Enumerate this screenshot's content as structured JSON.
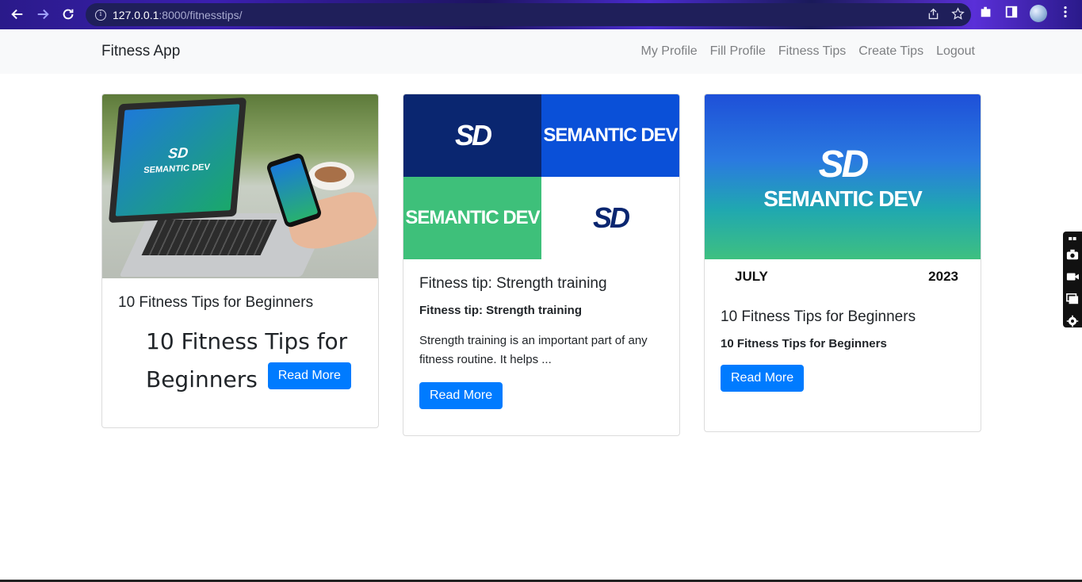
{
  "browser": {
    "url_host": "127.0.0.1",
    "url_rest": ":8000/fitnesstips/"
  },
  "navbar": {
    "brand": "Fitness App",
    "links": [
      "My Profile",
      "Fill Profile",
      "Fitness Tips",
      "Create Tips",
      "Logout"
    ]
  },
  "cards": [
    {
      "title": "10 Fitness Tips for Beginners",
      "body_large_line1": "10 Fitness Tips for",
      "body_large_line2": "Beginners",
      "button": "Read More",
      "image_logo_text": "SEMANTIC DEV"
    },
    {
      "title": "Fitness tip: Strength training",
      "subtitle": "Fitness tip: Strength training",
      "text": "Strength training is an important part of any fitness routine. It helps ...",
      "button": "Read More",
      "tile_text": "SEMANTIC DEV",
      "tile_logo": "SD"
    },
    {
      "title": "10 Fitness Tips for Beginners",
      "subtitle": "10 Fitness Tips for Beginners",
      "button": "Read More",
      "image_logo": "SD",
      "image_name": "SEMANTIC DEV",
      "date_month": "JULY",
      "date_year": "2023"
    }
  ]
}
